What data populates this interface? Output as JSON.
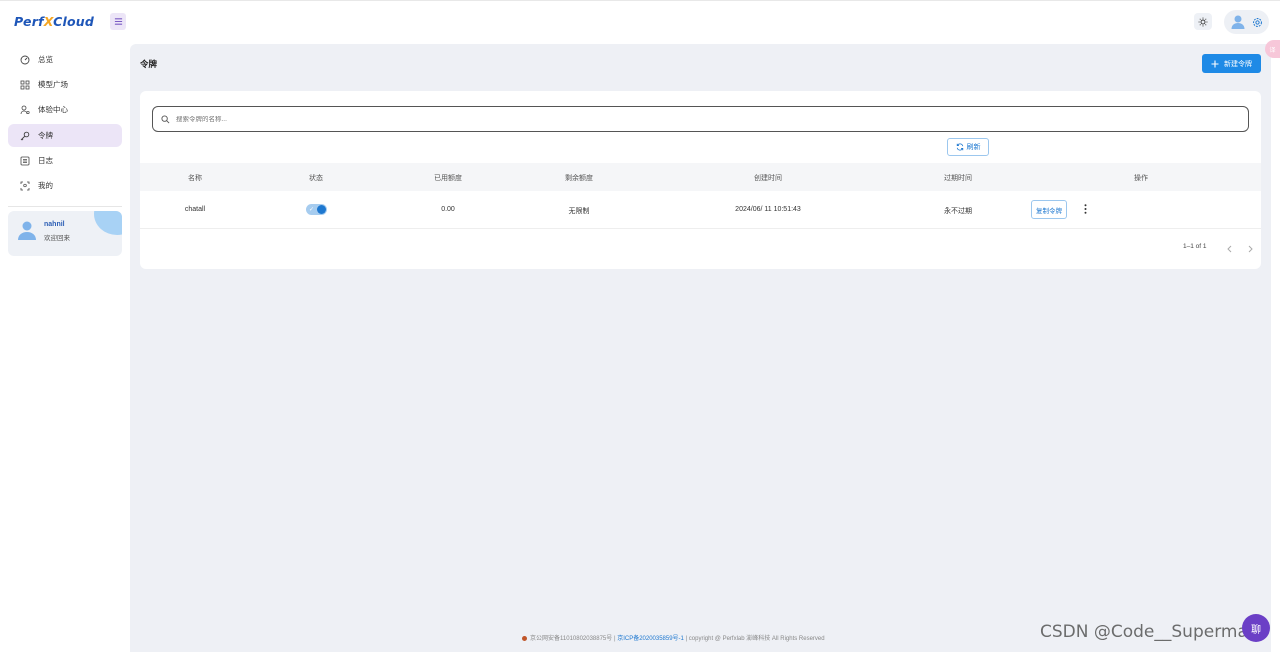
{
  "app": {
    "logo_left": "Perf",
    "logo_x": "X",
    "logo_right": "Cloud"
  },
  "sidebar": {
    "items": [
      {
        "label": "总览",
        "icon": "dashboard-icon"
      },
      {
        "label": "模型广场",
        "icon": "grid-icon"
      },
      {
        "label": "体验中心",
        "icon": "user-experience-icon"
      },
      {
        "label": "令牌",
        "icon": "key-icon",
        "active": true
      },
      {
        "label": "日志",
        "icon": "log-icon"
      },
      {
        "label": "我的",
        "icon": "profile-icon"
      }
    ],
    "user": {
      "name": "nahnil",
      "welcome": "欢迎回来"
    }
  },
  "main": {
    "title": "令牌",
    "new_button": "新建令牌",
    "search_placeholder": "搜索令牌的名称...",
    "refresh_label": "刷新",
    "table": {
      "headers": [
        "名称",
        "状态",
        "已用额度",
        "剩余额度",
        "创建时间",
        "过期时间",
        "操作"
      ],
      "rows": [
        {
          "name": "chatall",
          "status": "enabled",
          "used": "0.00",
          "remaining": "无限制",
          "created": "2024/06/ 11 10:51:43",
          "expires": "永不过期",
          "copy_label": "复制令牌"
        }
      ]
    },
    "pagination": "1–1 of 1"
  },
  "footer": {
    "police": "京公网安备11010802038875号",
    "sep1": " | ",
    "icp": "京ICP备2020035859号-1",
    "rest": " | copyright @ Perfxlab 澎峰科技 All Rights Reserved"
  },
  "overlay": {
    "watermark": "CSDN @Code__Superman",
    "side_tab": "译",
    "chat_fab": "聊"
  },
  "colors": {
    "accent": "#1e8ae6",
    "active_nav": "#ece5f7",
    "main_bg": "#eef0f5"
  }
}
